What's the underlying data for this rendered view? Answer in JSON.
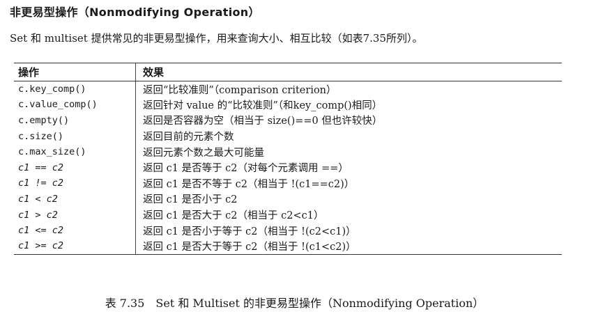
{
  "heading": "非更易型操作（Nonmodifying Operation）",
  "intro": "Set 和 multiset 提供常见的非更易型操作，用来查询大小、相互比较（如表7.35所列）。",
  "table": {
    "headers": [
      "操作",
      "效果"
    ],
    "rows": [
      {
        "op": "c.key_comp()",
        "effect": "返回“比较准则”（comparison criterion）"
      },
      {
        "op": "c.value_comp()",
        "effect": "返回针对 value 的“比较准则”（和key_comp()相同）"
      },
      {
        "op": "c.empty()",
        "effect": "返回是否容器为空（相当于 size()==0 但也许较快）"
      },
      {
        "op": "c.size()",
        "effect": "返回目前的元素个数"
      },
      {
        "op": "c.max_size()",
        "effect": "返回元素个数之最大可能量"
      },
      {
        "op": "c1 == c2",
        "effect": "返回 c1 是否等于 c2（对每个元素调用 ==）"
      },
      {
        "op": "c1 != c2",
        "effect": "返回 c1 是否不等于 c2（相当于 !(c1==c2)）"
      },
      {
        "op": "c1 < c2",
        "effect": "返回 c1 是否小于 c2"
      },
      {
        "op": "c1 > c2",
        "effect": "返回 c1 是否大于 c2（相当于 c2<c1）"
      },
      {
        "op": "c1 <= c2",
        "effect": "返回 c1 是否小于等于 c2（相当于 !(c2<c1)）"
      },
      {
        "op": "c1 >= c2",
        "effect": "返回 c1 是否大于等于 c2（相当于 !(c1<c2)）"
      }
    ]
  },
  "caption": "表 7.35　Set 和 Multiset 的非更易型操作（Nonmodifying Operation）"
}
